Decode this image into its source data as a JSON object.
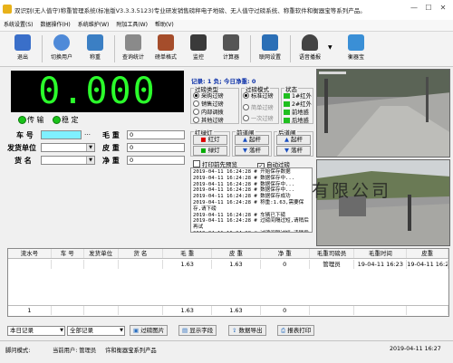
{
  "window": {
    "title": "双识别(无人值守)称重管理系统(标准版V3.3.3.5123)专业研发销售磅秤电子地磅、无人值守过磅系统、称重软件和衡器宝等系列产品。",
    "min": "—",
    "max": "☐",
    "close": "✕"
  },
  "menu": [
    "系统设置(S)",
    "数据操作(H)",
    "系统维护(W)",
    "附加工具(W)",
    "帮助(V)"
  ],
  "toolbar": {
    "items": [
      {
        "label": "退出",
        "icon": "exit-icon",
        "color": "#3a6fc9"
      },
      {
        "label": "切换用户",
        "icon": "switch-user-icon",
        "color": "#4f8ad8"
      },
      {
        "label": "称重",
        "icon": "weighing-icon",
        "color": "#3b7fc4"
      },
      {
        "label": "查询统计",
        "icon": "query-icon",
        "color": "#6a6a6a"
      },
      {
        "label": "磅单格式",
        "icon": "format-icon",
        "color": "#a54d2b"
      },
      {
        "label": "监控",
        "icon": "monitor-icon",
        "color": "#3a3a3a"
      },
      {
        "label": "计算器",
        "icon": "calculator-icon",
        "color": "#555"
      },
      {
        "label": "联网设置",
        "icon": "network-icon",
        "color": "#2b6fb6"
      },
      {
        "label": "语音播报",
        "icon": "voice-icon",
        "color": "#444"
      },
      {
        "label": "衡器宝",
        "icon": "scale-treasure-icon",
        "color": "#3a8fd6"
      }
    ]
  },
  "weight_display": "0.000",
  "indicators": {
    "transfer": "传 输",
    "stable": "稳 定"
  },
  "form": {
    "plate_label": "车 号",
    "plate_value": "",
    "dots": "…",
    "sender_label": "发货单位",
    "goods_label": "货 名",
    "gross_label": "毛 重",
    "gross_value": "0",
    "tare_label": "皮 重",
    "tare_value": "0",
    "net_label": "净 重",
    "net_value": "0"
  },
  "record_info": "记录: 1 负; 今日净重: 0",
  "weigh_type": {
    "title": "过磅类型",
    "options": [
      "采购过磅",
      "销售过磅",
      "内部调拨",
      "其他过磅"
    ],
    "selected": 0
  },
  "weigh_mode": {
    "title": "过磅模式",
    "options": [
      "标准过磅",
      "简单过磅",
      "一次过磅"
    ],
    "selected": 0
  },
  "state": {
    "title": "状态",
    "items": [
      "1#红外",
      "2#红外",
      "前地感",
      "后地感"
    ]
  },
  "traffic_light": {
    "title": "红绿灯",
    "red": "红灯",
    "green": "绿灯"
  },
  "front_gate": {
    "title": "前道闸",
    "up": "起杆",
    "down": "落杆"
  },
  "back_gate": {
    "title": "后道闸",
    "up": "起杆",
    "down": "落杆"
  },
  "print_preview": "打印前先预览",
  "auto_weigh": "自动过磅",
  "log_lines": [
    "2019-04-11 16:24:28 # 开始保存数据",
    "2019-04-11 16:24:28 # 数据保存中...",
    "2019-04-11 16:24:28 # 数据保存中...",
    "2019-04-11 16:24:28 # 数据保存中...",
    "2019-04-11 16:24:28 # 数据保存成功",
    "2019-04-11 16:24:28 # 称重:1.63,需要保存,请下磅",
    "2019-04-11 16:24:28 # 车辆已下磅",
    "2019-04-11 16:24:28 # 过磅间隔过短,请稍后再试",
    "2019-04-11 16:24:28 # 过磅间隔过短,请稍后再试"
  ],
  "camera_watermark": "有限公司",
  "table": {
    "columns": [
      "流水号",
      "车 号",
      "发货单位",
      "货 名",
      "毛 重",
      "皮 重",
      "净 重",
      "毛重司磅员",
      "毛重时间",
      "皮重"
    ],
    "rows": [
      [
        "",
        "",
        "",
        "",
        "1.63",
        "1.63",
        "0",
        "管理员",
        "19-04-11 16:23",
        "19-04-11 16:2"
      ]
    ],
    "total": [
      "1",
      "",
      "",
      "",
      "1.63",
      "1.63",
      "0",
      "",
      "",
      ""
    ]
  },
  "bottom": {
    "filter1": "本日记录",
    "filter2": "全部记录",
    "btn_photo": "过磅图片",
    "btn_fields": "显示字段",
    "btn_export": "数据导出",
    "btn_print": "报表打印"
  },
  "status_bar": {
    "mode": "脚问模式:",
    "user": "当前用户: 管理员",
    "company": "许和衡器宝系列产品",
    "datetime": "2019-04-11 16:27"
  }
}
